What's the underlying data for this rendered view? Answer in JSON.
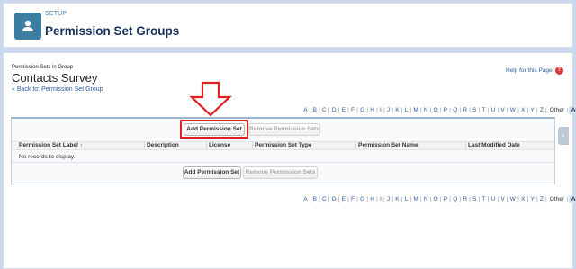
{
  "header": {
    "setup_label": "SETUP",
    "title": "Permission Set Groups",
    "icon": "user-icon"
  },
  "page": {
    "subtitle": "Permission Sets in Group",
    "title": "Contacts Survey",
    "back_link": "« Back to: Permission Set Group",
    "help_link": "Help for this Page"
  },
  "alphabet": [
    "A",
    "B",
    "C",
    "D",
    "E",
    "F",
    "G",
    "H",
    "I",
    "J",
    "K",
    "L",
    "M",
    "N",
    "O",
    "P",
    "Q",
    "R",
    "S",
    "T",
    "U",
    "V",
    "W",
    "X",
    "Y",
    "Z"
  ],
  "alpha_other": "Other",
  "alpha_all": "All",
  "buttons": {
    "add": "Add Permission Set",
    "remove": "Remove Permission Sets"
  },
  "table": {
    "columns": [
      "Permission Set Label",
      "Description",
      "License",
      "Permission Set Type",
      "Permission Set Name",
      "Last Modified Date"
    ],
    "sort_indicator": "↑",
    "empty_message": "No records to display."
  },
  "colors": {
    "accent": "#2a5ea3",
    "highlight": "#e02020",
    "header_icon_bg": "#3b7ea1"
  }
}
